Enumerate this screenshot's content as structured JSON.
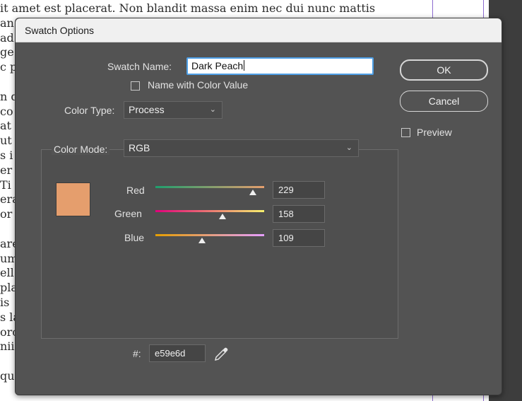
{
  "background": {
    "lines": [
      "it amet est placerat. Non blandit massa enim nec dui nunc mattis",
      "an",
      "ad",
      "ge",
      "c p",
      "",
      "n q",
      "co",
      "at",
      "ut",
      "s i",
      "er",
      " Ti",
      "era",
      "or",
      "",
      "are",
      "um",
      "ell",
      "pla",
      "is",
      "s la",
      "orc",
      "nii",
      "",
      "qui",
      ""
    ]
  },
  "dialog": {
    "title": "Swatch Options",
    "swatch_name_label": "Swatch Name:",
    "swatch_name_value": "Dark Peach",
    "name_with_color_value_label": "Name with Color Value",
    "name_with_color_value_checked": false,
    "color_type_label": "Color Type:",
    "color_type_value": "Process",
    "color_mode_label": "Color Mode:",
    "color_mode_value": "RGB",
    "ok_label": "OK",
    "cancel_label": "Cancel",
    "preview_label": "Preview",
    "preview_checked": false,
    "hex_label": "#:",
    "hex_value": "e59e6d",
    "swatch_color": "#e59e6d",
    "channels": [
      {
        "label": "Red",
        "value": "229",
        "fraction": 0.898
      },
      {
        "label": "Green",
        "value": "158",
        "fraction": 0.62
      },
      {
        "label": "Blue",
        "value": "109",
        "fraction": 0.427
      }
    ],
    "track_gradients": [
      "linear-gradient(to right, #1f9e6d, #e59e6d)",
      "linear-gradient(to right, #e0007a, #f7f06d)",
      "linear-gradient(to right, #e59e00, #e59eff)"
    ],
    "accent_color": "#4e9fe6"
  }
}
